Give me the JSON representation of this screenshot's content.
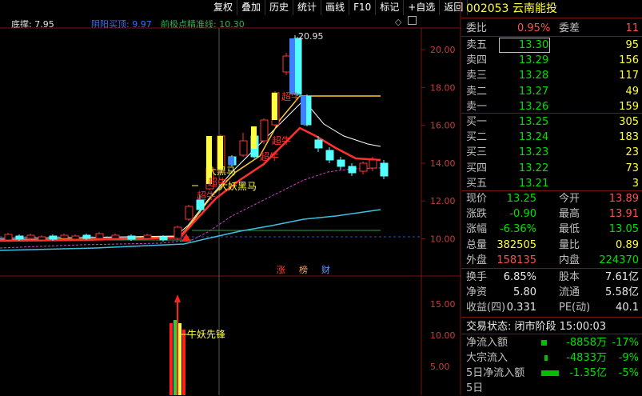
{
  "toolbar": [
    "复权",
    "叠加",
    "历史",
    "统计",
    "画线",
    "F10",
    "标记",
    "+自选",
    "返回"
  ],
  "indicators": {
    "dicheng": "底撑: 7.95",
    "yangyin": "阴阳买顶: 9.97",
    "jingzhun": "前极点精准线: 10.30"
  },
  "chart": {
    "yticks": [
      "20.00",
      "18.00",
      "16.00",
      "14.00",
      "12.00",
      "10.00"
    ],
    "lower_yticks": [
      "15.00",
      "10.00",
      "5.00"
    ],
    "high_label": "20.95",
    "annotations": [
      "超牛",
      "超牛",
      "超牛",
      "大黑马",
      "大妖黑马",
      "超牛",
      "超牛"
    ],
    "badges": [
      "涨",
      "榜",
      "财"
    ],
    "lower_label": "牛妖先锋",
    "colors": {
      "up": "#ff3232",
      "down": "#54ffff",
      "ma1": "#ffffff",
      "ma2": "#ffcc33",
      "ma3": "#ff3030",
      "ma4": "#cc44cc",
      "ma5": "#40c0e0",
      "label": "#ffff40"
    }
  },
  "quote": {
    "code": "002053",
    "name": "云南能投",
    "weibi_label": "委比",
    "weibi": "0.95%",
    "weicha_label": "委差",
    "weicha": "11",
    "asks": [
      {
        "label": "卖五",
        "price": "13.30",
        "vol": "95"
      },
      {
        "label": "卖四",
        "price": "13.29",
        "vol": "156"
      },
      {
        "label": "卖三",
        "price": "13.28",
        "vol": "117"
      },
      {
        "label": "卖二",
        "price": "13.27",
        "vol": "49"
      },
      {
        "label": "卖一",
        "price": "13.26",
        "vol": "159"
      }
    ],
    "bids": [
      {
        "label": "买一",
        "price": "13.25",
        "vol": "305"
      },
      {
        "label": "买二",
        "price": "13.24",
        "vol": "183"
      },
      {
        "label": "买三",
        "price": "13.23",
        "vol": "23"
      },
      {
        "label": "买四",
        "price": "13.22",
        "vol": "73"
      },
      {
        "label": "买五",
        "price": "13.21",
        "vol": "3"
      }
    ],
    "stats": [
      {
        "l1": "现价",
        "v1": "13.25",
        "l2": "今开",
        "v2": "13.89"
      },
      {
        "l1": "涨跌",
        "v1": "-0.90",
        "l2": "最高",
        "v2": "13.91"
      },
      {
        "l1": "涨幅",
        "v1": "-6.36%",
        "l2": "最低",
        "v2": "13.05"
      },
      {
        "l1": "总量",
        "v1": "382505",
        "l2": "量比",
        "v2": "0.89"
      },
      {
        "l1": "外盘",
        "v1": "158135",
        "l2": "内盘",
        "v2": "224370"
      }
    ],
    "stats2": [
      {
        "l1": "换手",
        "v1": "6.85%",
        "l2": "股本",
        "v2": "7.61亿"
      },
      {
        "l1": "净资",
        "v1": "5.80",
        "l2": "流通",
        "v2": "5.58亿"
      },
      {
        "l1": "收益(四)",
        "v1": "0.331",
        "l2": "PE(动)",
        "v2": "40.1"
      }
    ],
    "trade_state": "交易状态: 闭市阶段 15:00:03",
    "flows": [
      {
        "label": "净流入额",
        "value": "-8858万",
        "pct": "-17%"
      },
      {
        "label": "大宗流入",
        "value": "-4833万",
        "pct": "-9%"
      },
      {
        "label": "5日净流入额",
        "value": "-1.35亿",
        "pct": "-5%"
      },
      {
        "label": "5日",
        "value": "",
        "pct": ""
      }
    ]
  }
}
